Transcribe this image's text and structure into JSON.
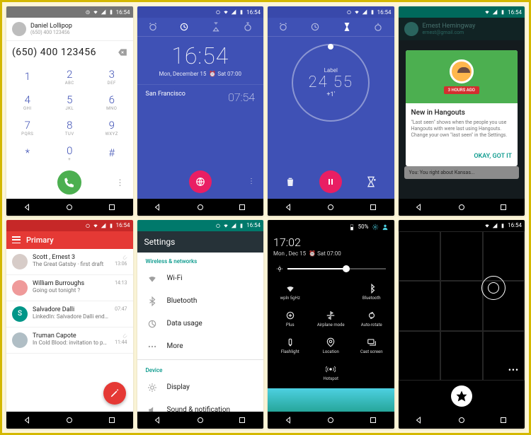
{
  "status": {
    "time": "16:54"
  },
  "dialer": {
    "contact_name": "Daniel Lollipop",
    "contact_num": "(650) 400 123456",
    "entered": "(650) 400 123456",
    "keys": [
      {
        "d": "1",
        "l": ""
      },
      {
        "d": "2",
        "l": "ABC"
      },
      {
        "d": "3",
        "l": "DEF"
      },
      {
        "d": "4",
        "l": "GHI"
      },
      {
        "d": "5",
        "l": "JKL"
      },
      {
        "d": "6",
        "l": "MNO"
      },
      {
        "d": "7",
        "l": "PQRS"
      },
      {
        "d": "8",
        "l": "TUV"
      },
      {
        "d": "9",
        "l": "WXYZ"
      },
      {
        "d": "*",
        "l": ""
      },
      {
        "d": "0",
        "l": "+"
      },
      {
        "d": "#",
        "l": ""
      }
    ]
  },
  "clock": {
    "time": "16:54",
    "date": "Mon, December 15",
    "alarm": "Sat 07:00",
    "tz_city": "San Francisco",
    "tz_time": "07:54"
  },
  "timer": {
    "label": "Label",
    "value": "24 55",
    "plus": "+1'"
  },
  "hangouts": {
    "header_name": "Ernest Hemingway",
    "header_sub": "ernest@gmail.com",
    "badge": "3 HOURS AGO",
    "card_title": "New in Hangouts",
    "card_text": "\"Last seen\" shows when the people you use Hangouts with were last using Hangouts. Change your own \"last seen\" in the Settings.",
    "card_action": "OKAY, GOT IT",
    "msg": "You: You right about Kansas..."
  },
  "gmail": {
    "title": "Primary",
    "items": [
      {
        "from": "Scott , Ernest  3",
        "subj": "The Great Gatsby · first draft",
        "time": "13:06",
        "color": "#d7ccc8",
        "att": true,
        "letter": ""
      },
      {
        "from": "William Burroughs",
        "subj": "Going out tonight ?",
        "time": "14:13",
        "color": "#ef9a9a",
        "att": false,
        "letter": ""
      },
      {
        "from": "Salvadore Dalli",
        "subj": "LinkedIn: Salvadore Dalli endorsed...",
        "time": "07:47",
        "color": "#009688",
        "att": false,
        "letter": "S"
      },
      {
        "from": "Truman Capote",
        "subj": "In Cold Blood: invitation to public ...",
        "time": "11:44",
        "color": "#b0bec5",
        "att": true,
        "letter": ""
      }
    ]
  },
  "settings": {
    "title": "Settings",
    "cat1": "Wireless & networks",
    "items1": [
      "Wi-Fi",
      "Bluetooth",
      "Data usage",
      "More"
    ],
    "cat2": "Device",
    "items2": [
      "Display",
      "Sound & notification"
    ]
  },
  "qs": {
    "battery": "50%",
    "time": "17:02",
    "date_line": "Mon , Dec 15",
    "alarm": "Sat 07:00",
    "tiles": [
      "wpln 5gHz",
      "",
      "Bluetooth",
      "Plus",
      "Airplane mode",
      "Auto-rotate",
      "Flashlight",
      "Location",
      "Cast screen",
      "",
      "Hotspot",
      ""
    ]
  }
}
